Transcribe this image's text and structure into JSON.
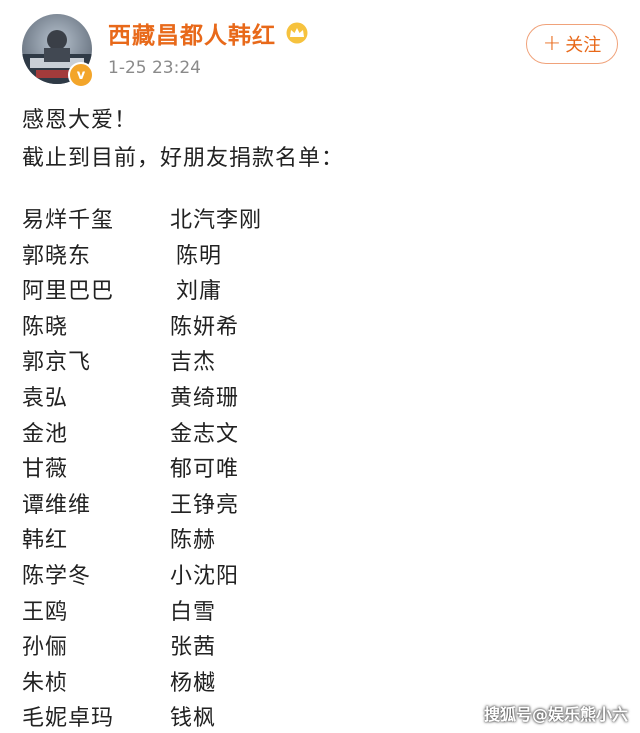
{
  "post": {
    "username": "西藏昌都人韩红",
    "timestamp": "1-25 23:24",
    "follow_label": "关注",
    "line1": "感恩大爱！",
    "line2": "截止到目前，好朋友捐款名单："
  },
  "donors": {
    "left": [
      "易烊千玺",
      "郭晓东",
      "阿里巴巴",
      "陈晓",
      "郭京飞",
      "袁弘",
      "金池",
      "甘薇",
      "谭维维",
      "韩红",
      "陈学冬",
      "王鸥",
      "孙俪",
      "朱桢",
      "毛妮卓玛"
    ],
    "right": [
      "北汽李刚",
      "陈明",
      "刘庸",
      "陈妍希",
      "吉杰",
      "黄绮珊",
      "金志文",
      "郁可唯",
      "王铮亮",
      "陈赫",
      "小沈阳",
      "白雪",
      "张茜",
      "杨樾",
      "钱枫"
    ]
  },
  "watermark": "搜狐号@娱乐熊小六",
  "colors": {
    "username": "#e8691a",
    "timestamp": "#8a8a8a",
    "follow_border": "#f0a27a",
    "badge": "#f3a52a"
  },
  "icons": [
    "avatar",
    "verified-badge-icon",
    "crown-icon",
    "plus-icon"
  ]
}
